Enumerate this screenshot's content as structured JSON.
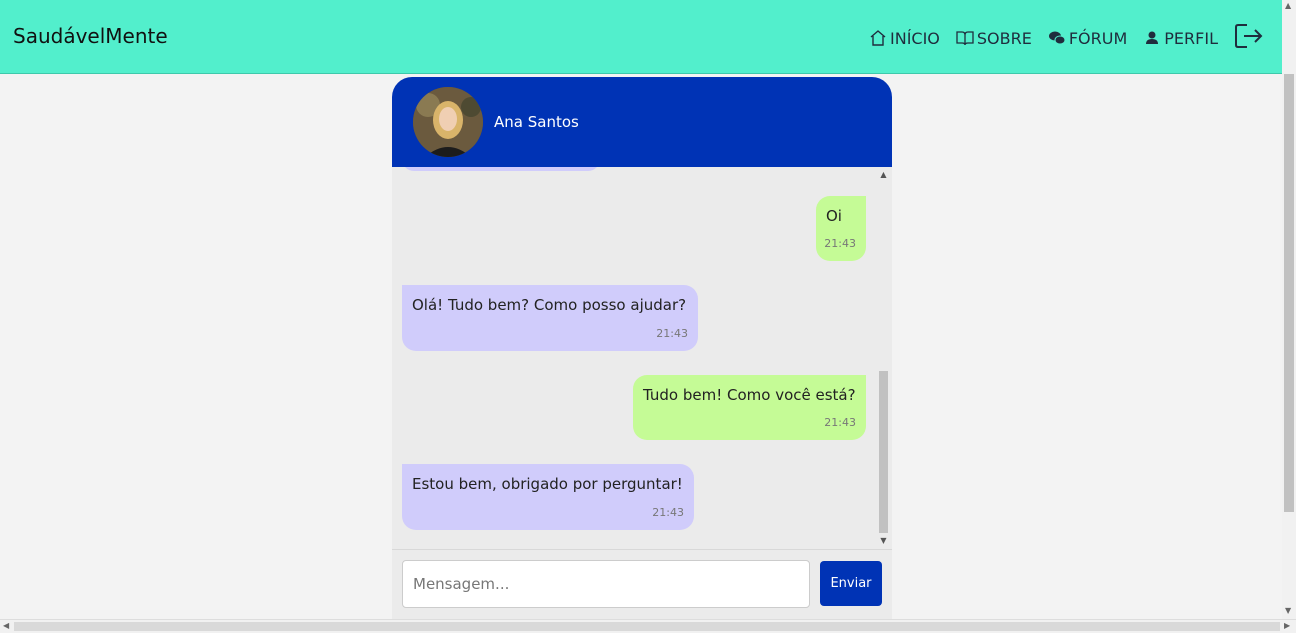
{
  "app": {
    "brand": "SaudávelMente"
  },
  "nav": {
    "items": [
      {
        "label": "INÍCIO",
        "icon": "home-icon"
      },
      {
        "label": "SOBRE",
        "icon": "book-icon"
      },
      {
        "label": "FÓRUM",
        "icon": "chat-icon"
      },
      {
        "label": "PERFIL",
        "icon": "user-icon"
      }
    ],
    "logout_icon": "logout-icon"
  },
  "chat": {
    "contact_name": "Ana Santos",
    "messages": [
      {
        "from": "me",
        "text": "Oi",
        "time": "21:43"
      },
      {
        "from": "contact",
        "text": "Olá! Tudo bem? Como posso ajudar?",
        "time": "21:43"
      },
      {
        "from": "me",
        "text": "Tudo bem! Como você está?",
        "time": "21:43"
      },
      {
        "from": "contact",
        "text": "Estou bem, obrigado por perguntar!",
        "time": "21:43"
      }
    ],
    "input_placeholder": "Mensagem...",
    "send_label": "Enviar"
  },
  "colors": {
    "navbar": "#52efcc",
    "header": "#0033b5",
    "incoming": "#d0ccfb",
    "outgoing": "#c5fb96"
  }
}
